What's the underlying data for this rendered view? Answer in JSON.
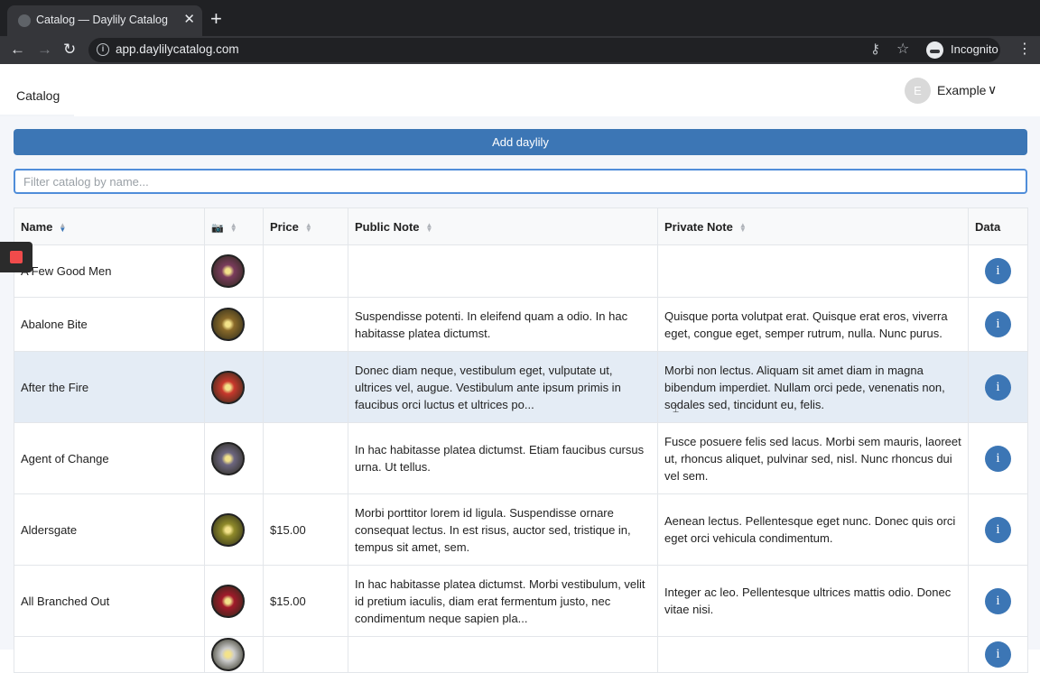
{
  "browser": {
    "tab_title": "Catalog — Daylily Catalog",
    "tab_close": "✕",
    "new_tab": "+",
    "back": "←",
    "forward": "→",
    "reload": "↻",
    "url": "app.daylilycatalog.com",
    "profile_label": "Incognito",
    "menu": "⋮",
    "key_glyph": "⚷",
    "star_glyph": "☆"
  },
  "header": {
    "nav_catalog": "Catalog",
    "user_initial": "E",
    "user_name": "Example",
    "user_chevron": "∨"
  },
  "actions": {
    "add_label": "Add daylily",
    "filter_placeholder": "Filter catalog by name...",
    "filter_value": ""
  },
  "table": {
    "columns": {
      "name": "Name",
      "photo": "📷",
      "price": "Price",
      "public_note": "Public Note",
      "private_note": "Private Note",
      "data": "Data"
    },
    "info_glyph": "i",
    "rows": [
      {
        "name": "A Few Good Men",
        "price": "",
        "public_note": "",
        "private_note": "",
        "photo_color": "#7a3b5c"
      },
      {
        "name": "Abalone Bite",
        "price": "",
        "public_note": "Suspendisse potenti. In eleifend quam a odio. In hac habitasse platea dictumst.",
        "private_note": "Quisque porta volutpat erat. Quisque erat eros, viverra eget, congue eget, semper rutrum, nulla. Nunc purus.",
        "photo_color": "#8a6a2a"
      },
      {
        "name": "After the Fire",
        "price": "",
        "public_note": "Donec diam neque, vestibulum eget, vulputate ut, ultrices vel, augue. Vestibulum ante ipsum primis in faucibus orci luctus et ultrices po...",
        "private_note": "Morbi non lectus. Aliquam sit amet diam in magna bibendum imperdiet. Nullam orci pede, venenatis non, sodales sed, tincidunt eu, felis.",
        "photo_color": "#c8382c"
      },
      {
        "name": "Agent of Change",
        "price": "",
        "public_note": "In hac habitasse platea dictumst. Etiam faucibus cursus urna. Ut tellus.",
        "private_note": "Fusce posuere felis sed lacus. Morbi sem mauris, laoreet ut, rhoncus aliquet, pulvinar sed, nisl. Nunc rhoncus dui vel sem.",
        "photo_color": "#6d6680"
      },
      {
        "name": "Aldersgate",
        "price": "$15.00",
        "public_note": "Morbi porttitor lorem id ligula. Suspendisse ornare consequat lectus. In est risus, auctor sed, tristique in, tempus sit amet, sem.",
        "private_note": "Aenean lectus. Pellentesque eget nunc. Donec quis orci eget orci vehicula condimentum.",
        "photo_color": "#8f8a2a"
      },
      {
        "name": "All Branched Out",
        "price": "$15.00",
        "public_note": "In hac habitasse platea dictumst. Morbi vestibulum, velit id pretium iaculis, diam erat fermentum justo, nec condimentum neque sapien pla...",
        "private_note": "Integer ac leo. Pellentesque ultrices mattis odio. Donec vitae nisi.",
        "photo_color": "#a11a2a"
      },
      {
        "name": "",
        "price": "",
        "public_note": "",
        "private_note": "",
        "photo_color": "#cccccc"
      }
    ],
    "highlighted_row": 2
  }
}
